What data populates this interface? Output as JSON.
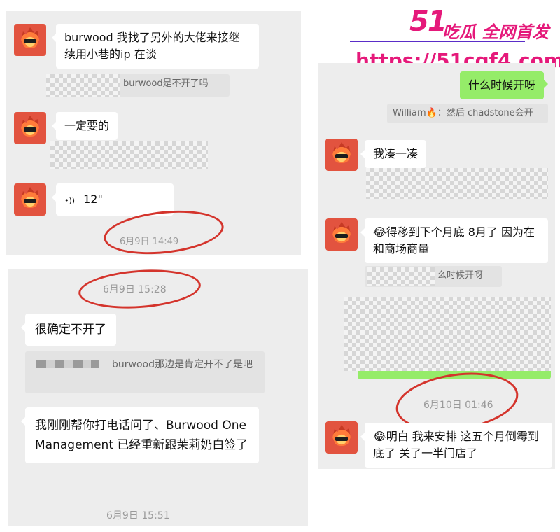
{
  "watermark": {
    "brand_number": "51",
    "brand_text": "吃瓜 全网首发",
    "url": "https://51cgf4.com"
  },
  "panel1": {
    "msg1": "burwood 我找了另外的大佬来接继续用小巷的ip 在谈",
    "quote1": "burwood是不开了吗",
    "msg2": "一定要的",
    "voice_icon": "•))",
    "voice_duration": "12\"",
    "timestamp": "6月9日 14:49"
  },
  "panel2": {
    "timestamp_top": "6月9日 15:28",
    "msg1": "很确定不开了",
    "quote1": "burwood那边是肯定开不了是吧",
    "msg2": "我刚刚帮你打电话问了、Burwood One Management 已经重新跟茉莉奶白签了",
    "timestamp_bottom": "6月9日 15:51"
  },
  "panel3": {
    "sent1": "什么时候开呀",
    "quote1": "William🔥：然后 chadstone会开",
    "msg1": "我凑一凑",
    "msg2": "😂得移到下个月底 8月了 因为在和商场商量",
    "quote2": "么时候开呀",
    "timestamp": "6月10日 01:46",
    "msg3": "😂明白 我来安排 这五个月倒霉到底了 关了一半门店了"
  },
  "colors": {
    "chat_bg": "#ededed",
    "green_bubble": "#95ec69",
    "annotation_red": "#d4342c",
    "brand_pink": "#e5197a"
  },
  "icons": [
    "avatar-flame-icon",
    "voice-icon"
  ]
}
